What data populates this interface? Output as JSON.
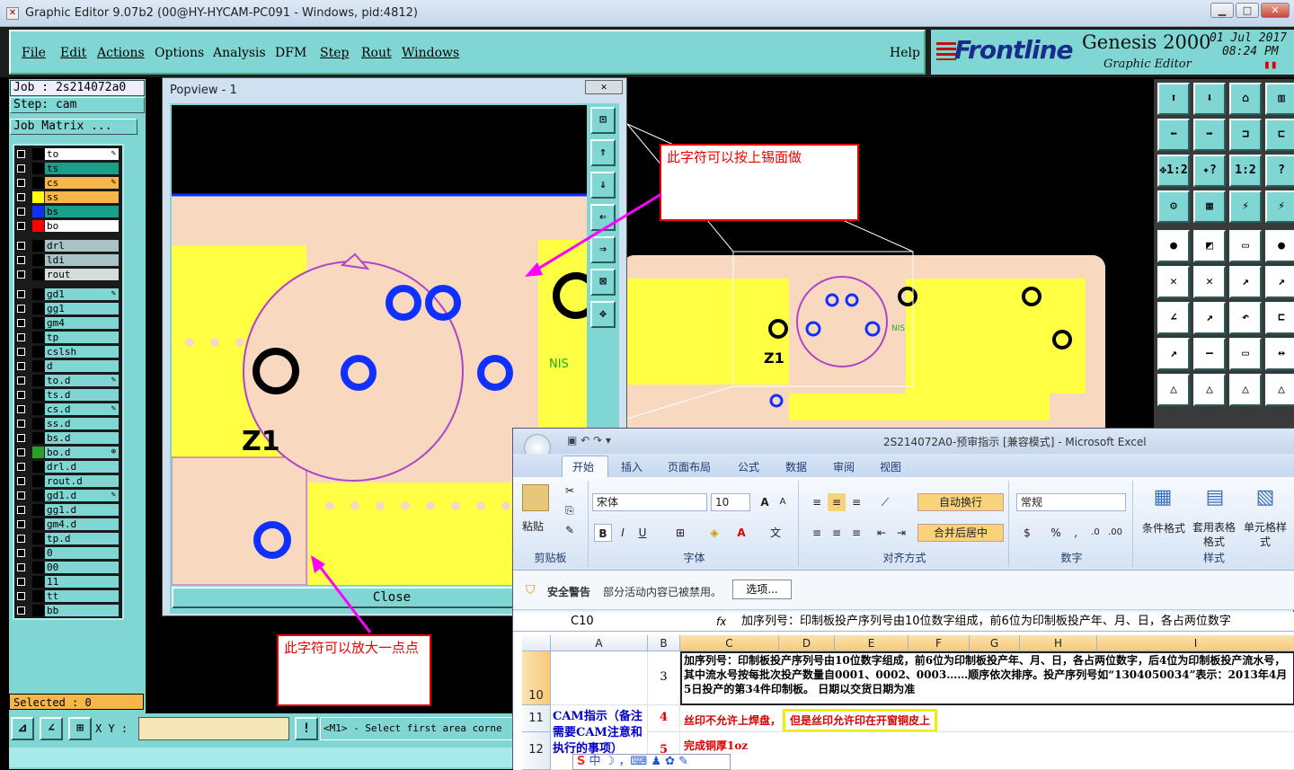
{
  "window": {
    "title": "Graphic Editor 9.07b2 (00@HY-HYCAM-PC091 - Windows, pid:4812)",
    "controls": [
      "▁",
      "□",
      "✕"
    ]
  },
  "menu": {
    "items": [
      "File",
      "Edit",
      "Actions",
      "Options",
      "Analysis",
      "DFM",
      "Step",
      "Rout",
      "Windows"
    ],
    "help": "Help"
  },
  "logo": {
    "brand": "Frontline",
    "product": "Genesis 2000",
    "subtitle": "Graphic Editor",
    "date": "01 Jul 2017",
    "time": "08:24 PM"
  },
  "left": {
    "job": "Job : 2s214072a0",
    "step": "Step: cam",
    "matrix_button": "Job Matrix ...",
    "selected": "Selected : 0",
    "layers": [
      {
        "name": "to",
        "color": "#ffffff",
        "swatch": "#000000",
        "edit": "✎"
      },
      {
        "name": "ts",
        "color": "#1aa08a",
        "swatch": "#000000",
        "edit": ""
      },
      {
        "name": "cs",
        "color": "#f7b64a",
        "swatch": "#000000",
        "edit": "✎"
      },
      {
        "name": "ss",
        "color": "#f7b64a",
        "swatch": "#ffff00",
        "edit": ""
      },
      {
        "name": "bs",
        "color": "#1aa08a",
        "swatch": "#1030ff",
        "edit": ""
      },
      {
        "name": "bo",
        "color": "#ffffff",
        "swatch": "#ff0000",
        "edit": ""
      },
      {
        "name": "drl",
        "color": "#a7c3c6",
        "swatch": "#000000",
        "edit": ""
      },
      {
        "name": "ldi",
        "color": "#a7c3c6",
        "swatch": "#000000",
        "edit": ""
      },
      {
        "name": "rout",
        "color": "#d6dcdc",
        "swatch": "#000000",
        "edit": ""
      },
      {
        "name": "gd1",
        "color": "#7fd6d2",
        "swatch": "#000000",
        "edit": "✎"
      },
      {
        "name": "gg1",
        "color": "#7fd6d2",
        "swatch": "#000000",
        "edit": ""
      },
      {
        "name": "gm4",
        "color": "#7fd6d2",
        "swatch": "#000000",
        "edit": ""
      },
      {
        "name": "tp",
        "color": "#7fd6d2",
        "swatch": "#000000",
        "edit": ""
      },
      {
        "name": "cslsh",
        "color": "#7fd6d2",
        "swatch": "#000000",
        "edit": ""
      },
      {
        "name": "d",
        "color": "#7fd6d2",
        "swatch": "#000000",
        "edit": ""
      },
      {
        "name": "to.d",
        "color": "#7fd6d2",
        "swatch": "#000000",
        "edit": "✎"
      },
      {
        "name": "ts.d",
        "color": "#7fd6d2",
        "swatch": "#000000",
        "edit": ""
      },
      {
        "name": "cs.d",
        "color": "#7fd6d2",
        "swatch": "#000000",
        "edit": "✎"
      },
      {
        "name": "ss.d",
        "color": "#7fd6d2",
        "swatch": "#000000",
        "edit": ""
      },
      {
        "name": "bs.d",
        "color": "#7fd6d2",
        "swatch": "#000000",
        "edit": ""
      },
      {
        "name": "bo.d",
        "color": "#7fd6d2",
        "swatch": "#2aa02a",
        "edit": "⊕"
      },
      {
        "name": "drl.d",
        "color": "#7fd6d2",
        "swatch": "#000000",
        "edit": ""
      },
      {
        "name": "rout.d",
        "color": "#7fd6d2",
        "swatch": "#000000",
        "edit": ""
      },
      {
        "name": "gd1.d",
        "color": "#7fd6d2",
        "swatch": "#000000",
        "edit": "✎"
      },
      {
        "name": "gg1.d",
        "color": "#7fd6d2",
        "swatch": "#000000",
        "edit": ""
      },
      {
        "name": "gm4.d",
        "color": "#7fd6d2",
        "swatch": "#000000",
        "edit": ""
      },
      {
        "name": "tp.d",
        "color": "#7fd6d2",
        "swatch": "#000000",
        "edit": ""
      },
      {
        "name": "0",
        "color": "#7fd6d2",
        "swatch": "#000000",
        "edit": ""
      },
      {
        "name": "00",
        "color": "#7fd6d2",
        "swatch": "#000000",
        "edit": ""
      },
      {
        "name": "11",
        "color": "#7fd6d2",
        "swatch": "#000000",
        "edit": ""
      },
      {
        "name": "tt",
        "color": "#7fd6d2",
        "swatch": "#000000",
        "edit": ""
      },
      {
        "name": "bb",
        "color": "#7fd6d2",
        "swatch": "#000000",
        "edit": ""
      }
    ]
  },
  "popview": {
    "title": "Popview - 1",
    "close_x": "✕",
    "close_button": "Close",
    "board_text": "Z1"
  },
  "main_board_text": [
    "Z1",
    "NIS"
  ],
  "notes": {
    "top": "此字符可以按上锡面做",
    "bottom": "此字符可以放大一点点"
  },
  "bottom": {
    "xy_label": "X Y :",
    "xy_value": "",
    "prompt": "<M1> - Select first area corne"
  },
  "right_toolbar": {
    "labels": [
      "",
      "",
      "",
      "",
      "",
      "",
      "",
      "",
      "1:2",
      "?",
      "",
      "",
      "",
      "",
      "",
      "",
      "",
      "",
      "",
      "",
      "",
      "",
      "",
      "",
      "",
      "",
      "",
      "",
      "",
      "",
      "",
      "",
      "",
      "",
      "",
      ""
    ]
  },
  "excel": {
    "title": "2S214072A0-预审指示 [兼容模式] - Microsoft Excel",
    "tabs": [
      "开始",
      "插入",
      "页面布局",
      "公式",
      "数据",
      "审阅",
      "视图"
    ],
    "clipboard": {
      "paste": "粘贴",
      "group": "剪贴板"
    },
    "font": {
      "name": "宋体",
      "size": "10",
      "group": "字体"
    },
    "align": {
      "wrap": "自动换行",
      "merge": "合并后居中",
      "group": "对齐方式"
    },
    "number": {
      "format": "常规",
      "group": "数字"
    },
    "styles": {
      "cond": "条件格式",
      "table": "套用表格格式",
      "cell": "单元格样式",
      "group": "样式"
    },
    "security": {
      "label": "安全警告",
      "message": "部分活动内容已被禁用。",
      "button": "选项..."
    },
    "namebox": "C10",
    "fx": "fx",
    "formula": "加序列号：印制板投产序列号由10位数字组成，前6位为印制板投产年、月、日，各占两位数字",
    "columns": [
      "A",
      "B",
      "C",
      "D",
      "E",
      "F",
      "G",
      "H",
      "I"
    ],
    "rows": [
      {
        "num": "10",
        "b": "3",
        "c": "加序列号：印制板投产序列号由10位数字组成，前6位为印制板投产年、月、日，各占两位数字，后4位为印制板投产流水号，其中流水号按每批次投产数量自0001、0002、0003……顺序依次排序。投产序列号如“1304050034”表示：2013年4月5日投产的第34件印制板。 日期以交货日期为准"
      },
      {
        "num": "11",
        "b": "4",
        "c": "丝印不允许上焊盘，",
        "c2": "但是丝印允许印在开窗铜皮上"
      },
      {
        "num": "12",
        "b": "5",
        "c": "完成铜厚1oz"
      }
    ],
    "a_merged": "CAM指示（备注需要CAM注意和执行的事项）",
    "ime": "中"
  }
}
